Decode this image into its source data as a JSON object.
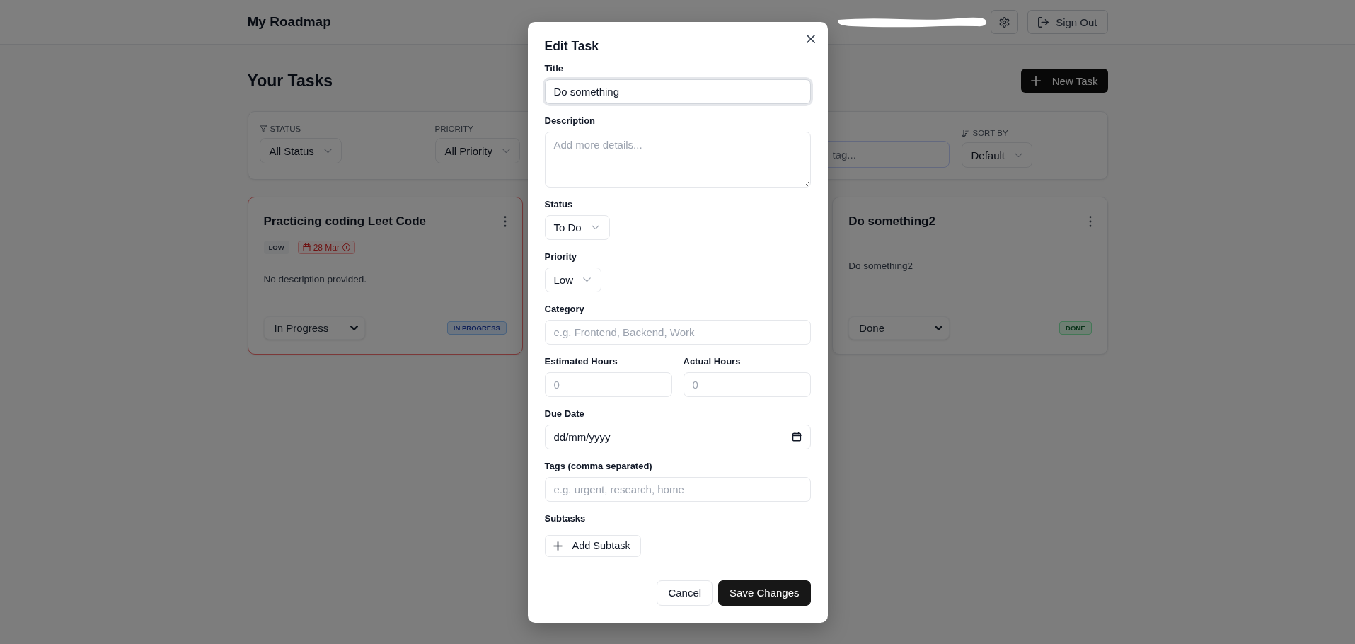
{
  "header": {
    "title": "My Roadmap",
    "sign_out": "Sign Out"
  },
  "tasks_view": {
    "heading": "Your Tasks",
    "new_task": "New Task",
    "filters": {
      "status": {
        "label": "STATUS",
        "value": "All Status"
      },
      "priority": {
        "label": "PRIORITY",
        "value": "All Priority"
      },
      "search": {
        "placeholder": "tag..."
      },
      "sort": {
        "label": "SORT BY",
        "value": "Default"
      }
    },
    "cards": [
      {
        "title": "Practicing coding Leet Code",
        "overdue": true,
        "priority": "LOW",
        "due_date": "28 Mar",
        "description": "No description provided.",
        "status_value": "In Progress",
        "status_tag": "IN PROGRESS",
        "kind": "progress"
      },
      {
        "title": "Do something2",
        "overdue": false,
        "description": "Do something2",
        "status_value": "Done",
        "status_tag": "DONE",
        "kind": "done"
      }
    ]
  },
  "modal": {
    "title": "Edit Task",
    "fields": [
      {
        "kind": "text",
        "label": "Title",
        "value": "Do something",
        "focused": true
      },
      {
        "kind": "textarea",
        "label": "Description",
        "placeholder": "Add more details...",
        "focused": false
      },
      {
        "kind": "select",
        "label": "Status",
        "value": "To Do",
        "focused": false
      },
      {
        "kind": "select",
        "label": "Priority",
        "value": "Low",
        "focused": false
      },
      {
        "kind": "text",
        "label": "Category",
        "placeholder": "e.g. Frontend, Backend, Work",
        "focused": false
      },
      {
        "kind": "pair",
        "fields": [
          {
            "kind": "text",
            "label": "Estimated Hours",
            "placeholder": "0",
            "focused": false
          },
          {
            "kind": "text",
            "label": "Actual Hours",
            "placeholder": "0",
            "focused": false
          }
        ]
      },
      {
        "kind": "date",
        "label": "Due Date",
        "placeholder": "dd/mm/yyyy",
        "focused": false
      },
      {
        "kind": "text",
        "label": "Tags (comma separated)",
        "placeholder": "e.g. urgent, research, home",
        "focused": false
      }
    ],
    "subtasks": {
      "label": "Subtasks",
      "add_button": "Add Subtask"
    },
    "buttons": {
      "cancel": "Cancel",
      "save": "Save Changes"
    }
  }
}
